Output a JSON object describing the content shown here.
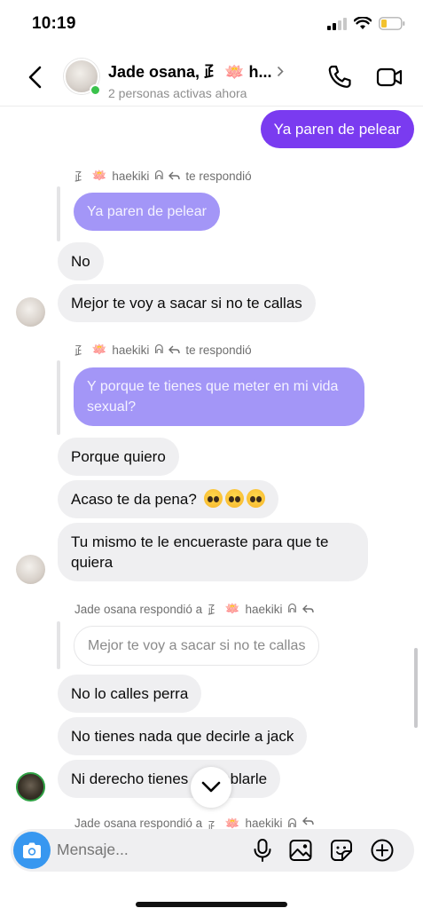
{
  "status": {
    "time": "10:19"
  },
  "header": {
    "title": "Jade osana, ⺪ 🪷 h...",
    "subtitle": "2 personas activas ahora"
  },
  "messages": {
    "m1": "Ya paren de pelear",
    "reply1_user": "haekiki",
    "reply1_action": "te respondió",
    "quote1": "Ya paren de pelear",
    "m2": "No",
    "m3": "Mejor te voy a sacar si no te callas",
    "reply2_user": "haekiki",
    "reply2_action": "te respondió",
    "quote2": "Y porque te tienes que meter en mi vida sexual?",
    "m4": "Porque quiero",
    "m5": "Acaso te da pena?",
    "m6": "Tu mismo te le encueraste para que te quiera",
    "reply3_prefix": "Jade osana respondió a",
    "reply3_user": "haekiki",
    "quote3": "Mejor te voy a sacar si no te callas",
    "m7": "No lo calles perra",
    "m8": "No tienes nada que decirle a jack",
    "m9": "Ni derecho tienes de hablarle",
    "reply4_prefix": "Jade osana respondió a",
    "reply4_user": "haekiki"
  },
  "composer": {
    "placeholder": "Mensaje..."
  },
  "colors": {
    "outgoing": "#7a3bf0",
    "quoted_outgoing": "#a396f7",
    "incoming": "#efeff1",
    "camera": "#3797f0",
    "online": "#3ac24b"
  },
  "icons": [
    "back-chevron-icon",
    "phone-icon",
    "video-camera-icon",
    "camera-icon",
    "microphone-icon",
    "gallery-icon",
    "sticker-icon",
    "plus-circle-icon",
    "chevron-down-icon"
  ]
}
